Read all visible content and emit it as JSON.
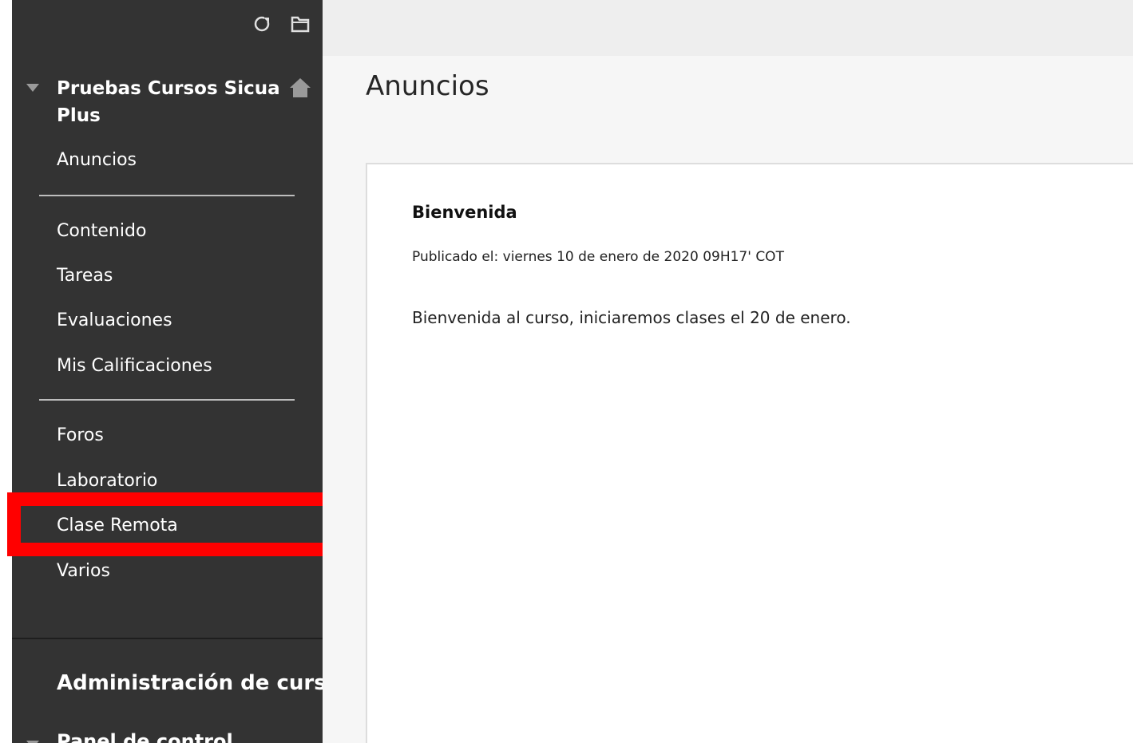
{
  "sidebar": {
    "tools": [
      {
        "name": "refresh-icon"
      },
      {
        "name": "folder-icon"
      }
    ],
    "course_title": "Pruebas Cursos Sicua Plus",
    "items": [
      {
        "label": "Anuncios"
      },
      {
        "label": "Contenido"
      },
      {
        "label": "Tareas"
      },
      {
        "label": "Evaluaciones"
      },
      {
        "label": "Mis Calificaciones"
      },
      {
        "label": "Foros"
      },
      {
        "label": "Laboratorio"
      },
      {
        "label": "Clase Remota"
      },
      {
        "label": "Varios"
      }
    ],
    "admin_title": "Administración de cursos",
    "panel_label": "Panel de control"
  },
  "highlight": {
    "target": "Clase Remota",
    "color": "#ff0000"
  },
  "main": {
    "page_title": "Anuncios",
    "announcement": {
      "title": "Bienvenida",
      "posted": "Publicado el: viernes 10 de enero de 2020 09H17' COT",
      "body": "Bienvenida al curso, iniciaremos clases el 20 de enero."
    }
  },
  "colors": {
    "sidebar_bg": "#333333",
    "top_bar_bg": "#eeeeee",
    "main_bg": "#f6f6f6",
    "highlight": "#ff0000"
  }
}
